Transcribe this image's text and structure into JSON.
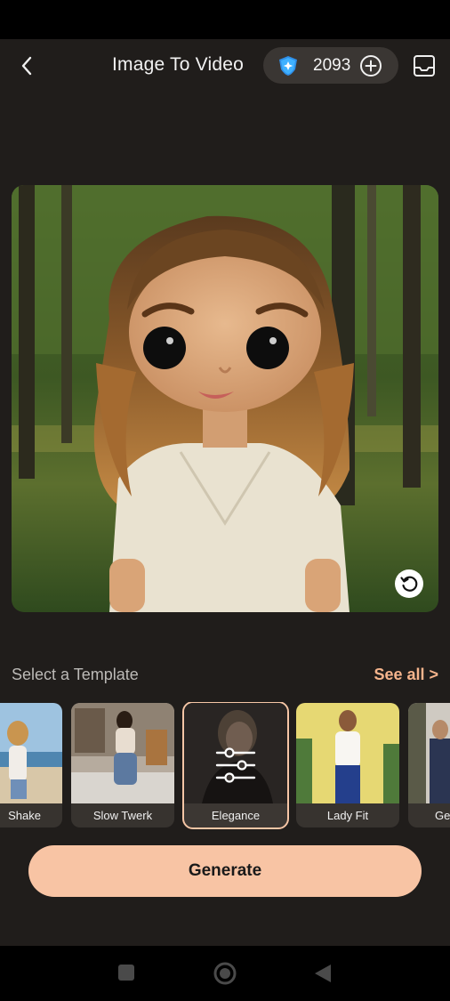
{
  "header": {
    "title": "Image To Video",
    "credits": "2093"
  },
  "icons": {
    "back": "chevron-left-icon",
    "credit_badge": "shield-gem-icon",
    "add": "plus-circle-icon",
    "inbox": "inbox-tray-icon",
    "rotate": "rotate-ccw-icon",
    "adjust": "sliders-icon"
  },
  "templates": {
    "title": "Select a Template",
    "see_all": "See all >",
    "items": [
      {
        "label": "Shake"
      },
      {
        "label": "Slow Twerk"
      },
      {
        "label": "Elegance",
        "selected": true
      },
      {
        "label": "Lady Fit"
      },
      {
        "label": "Ge"
      }
    ]
  },
  "actions": {
    "generate": "Generate"
  },
  "colors": {
    "background": "#201d1b",
    "accent": "#f8c4a4",
    "see_all": "#f5b48c",
    "credits_pill": "#3a3633"
  }
}
